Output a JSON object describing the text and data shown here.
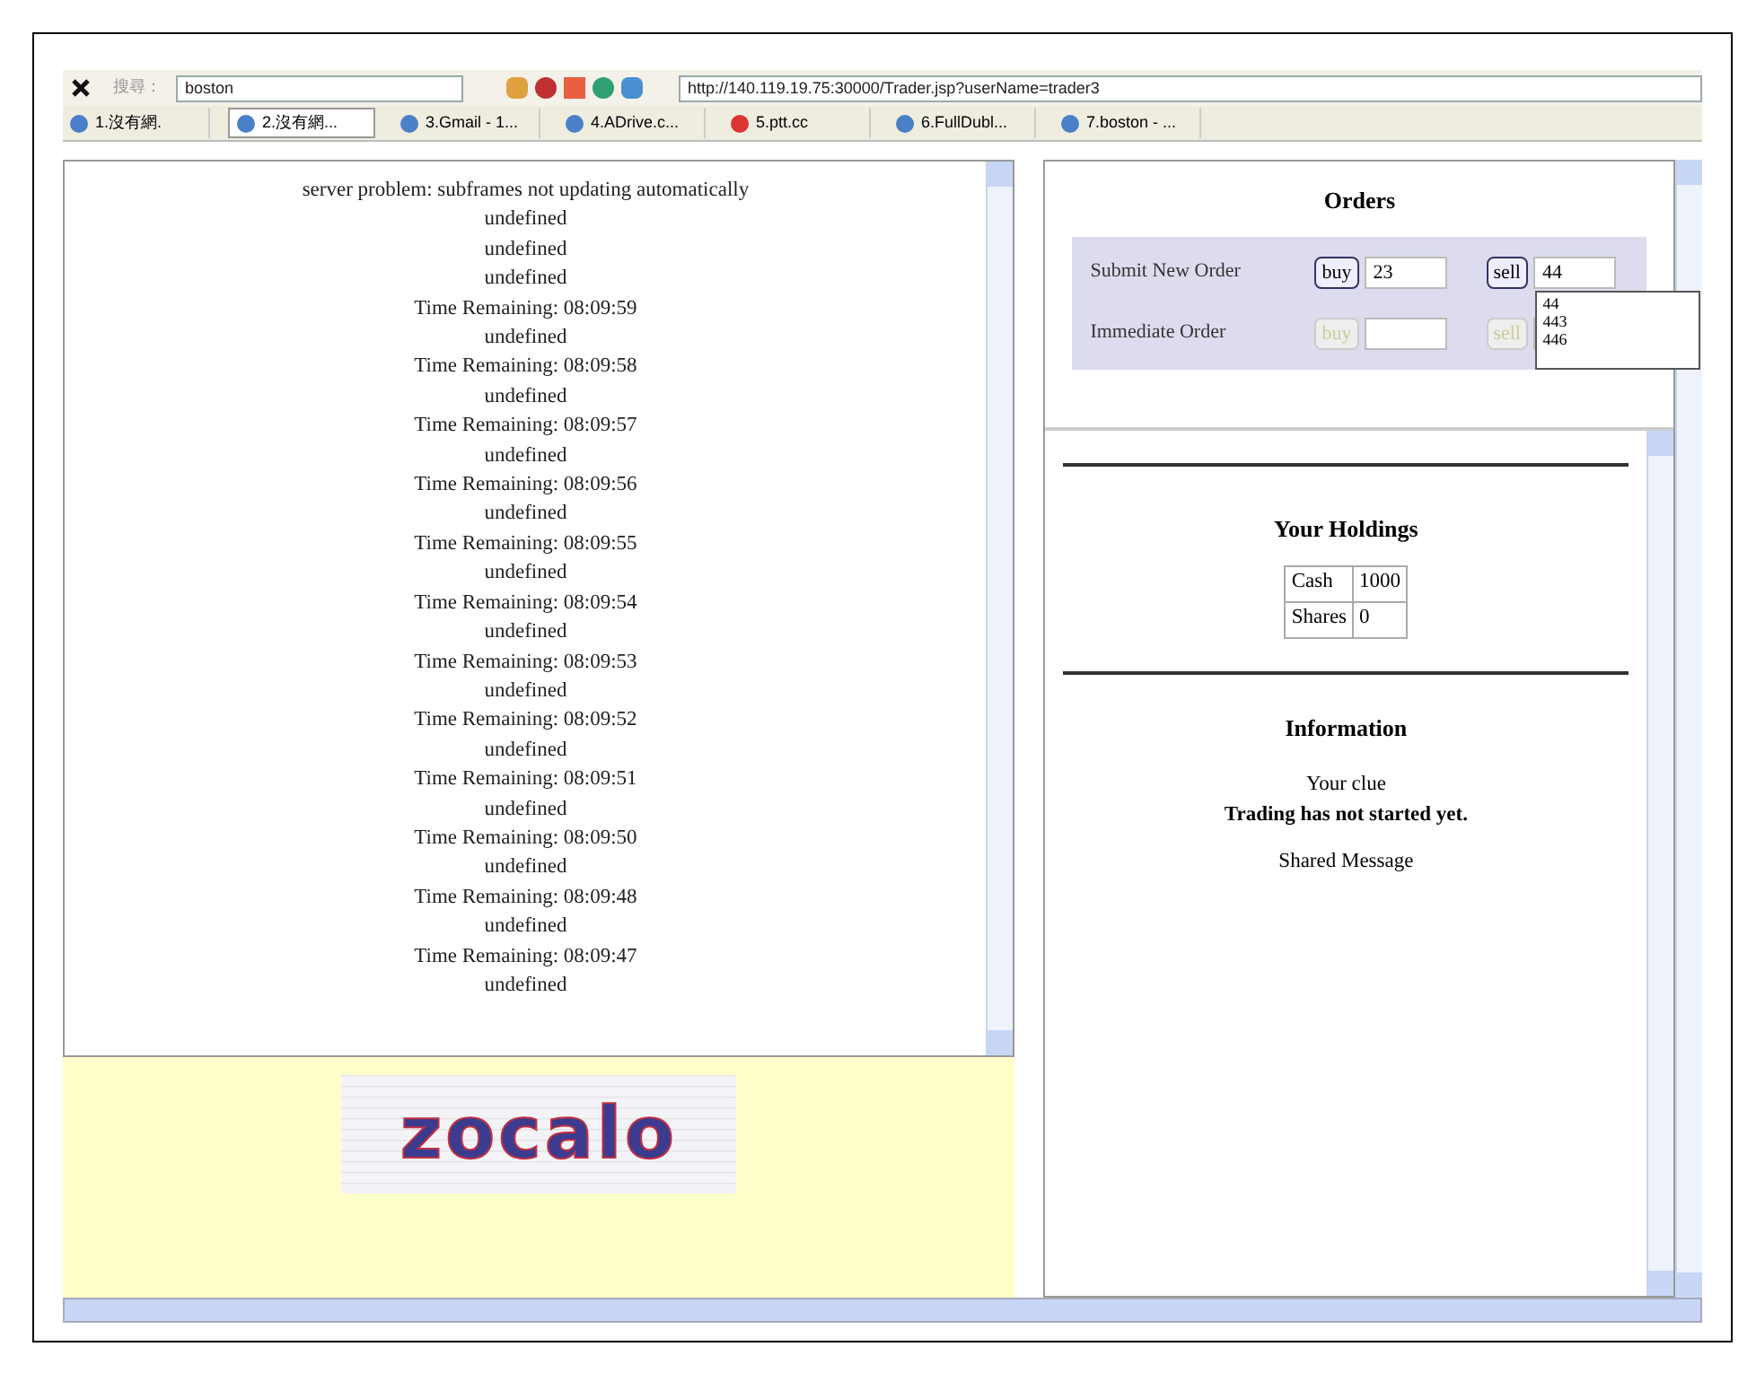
{
  "toolbar": {
    "search_label": "搜尋：",
    "search_value": "boston",
    "address": "http://140.119.19.75:30000/Trader.jsp?userName=trader3"
  },
  "tabs": [
    {
      "label": "1.沒有網.",
      "selected": false
    },
    {
      "label": "2.沒有網...",
      "selected": true
    },
    {
      "label": "3.Gmail - 1...",
      "selected": false
    },
    {
      "label": "4.ADrive.c...",
      "selected": false
    },
    {
      "label": "5.ptt.cc",
      "selected": false,
      "kind": "red"
    },
    {
      "label": "6.FullDubl...",
      "selected": false
    },
    {
      "label": "7.boston - ...",
      "selected": false
    }
  ],
  "log": [
    "server problem: subframes not updating automatically",
    "undefined",
    "undefined",
    "undefined",
    "Time Remaining: 08:09:59",
    "undefined",
    "Time Remaining: 08:09:58",
    "undefined",
    "Time Remaining: 08:09:57",
    "undefined",
    "Time Remaining: 08:09:56",
    "undefined",
    "Time Remaining: 08:09:55",
    "undefined",
    "Time Remaining: 08:09:54",
    "undefined",
    "Time Remaining: 08:09:53",
    "undefined",
    "Time Remaining: 08:09:52",
    "undefined",
    "Time Remaining: 08:09:51",
    "undefined",
    "Time Remaining: 08:09:50",
    "undefined",
    "Time Remaining: 08:09:48",
    "undefined",
    "Time Remaining: 08:09:47",
    "undefined"
  ],
  "logo": "zocalo",
  "orders": {
    "title": "Orders",
    "rows": [
      {
        "label": "Submit New Order",
        "buy": "buy",
        "buy_value": "23",
        "sell": "sell",
        "sell_value": "44",
        "disabled": false
      },
      {
        "label": "Immediate Order",
        "buy": "buy",
        "buy_value": "",
        "sell": "sell",
        "sell_value": "",
        "disabled": true
      }
    ],
    "suggestions": [
      "44",
      "443",
      "446"
    ]
  },
  "holdings": {
    "title": "Your Holdings",
    "rows": [
      [
        "Cash",
        "1000"
      ],
      [
        "Shares",
        "0"
      ]
    ]
  },
  "information": {
    "title": "Information",
    "clue": "Your clue",
    "status": "Trading has not started yet.",
    "shared": "Shared Message"
  }
}
